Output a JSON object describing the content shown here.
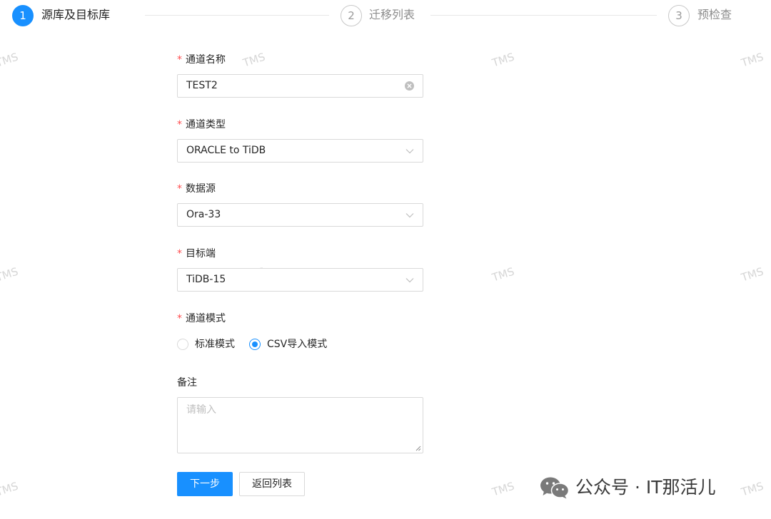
{
  "steps": [
    {
      "number": "1",
      "title": "源库及目标库",
      "status": "active"
    },
    {
      "number": "2",
      "title": "迁移列表",
      "status": "wait"
    },
    {
      "number": "3",
      "title": "预检查",
      "status": "wait"
    }
  ],
  "form": {
    "channel_name": {
      "label": "通道名称",
      "value": "TEST2",
      "required": true
    },
    "channel_type": {
      "label": "通道类型",
      "value": "ORACLE to TiDB",
      "required": true
    },
    "data_source": {
      "label": "数据源",
      "value": "Ora-33",
      "required": true
    },
    "target": {
      "label": "目标端",
      "value": "TiDB-15",
      "required": true
    },
    "channel_mode": {
      "label": "通道模式",
      "required": true,
      "options": [
        {
          "label": "标准模式",
          "checked": false
        },
        {
          "label": "CSV导入模式",
          "checked": true
        }
      ]
    },
    "remark": {
      "label": "备注",
      "placeholder": "请输入"
    },
    "required_mark": "*"
  },
  "buttons": {
    "next": "下一步",
    "back": "返回列表"
  },
  "watermark": "TMS",
  "footer": {
    "brand_text": "公众号 · IT那活儿",
    "icon": "wechat-icon"
  },
  "colors": {
    "primary": "#1890ff",
    "required": "#ff4d4f",
    "border": "#d9d9d9",
    "watermark": "#d6d6d6"
  }
}
